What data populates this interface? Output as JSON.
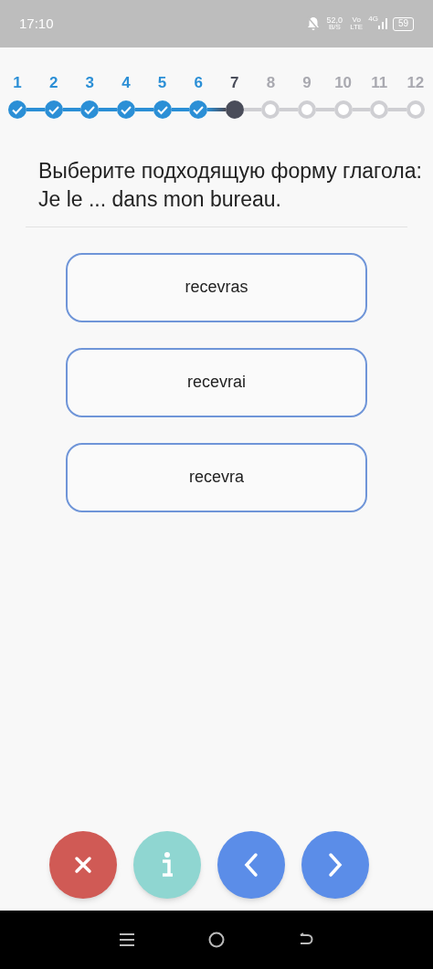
{
  "status_bar": {
    "time": "17:10",
    "speed": "52,0",
    "speed_unit": "B/S",
    "volte_top": "Vo",
    "volte_bottom": "LTE",
    "network": "4G",
    "battery": "59"
  },
  "steps": [
    {
      "label": "1",
      "done": true,
      "current": false
    },
    {
      "label": "2",
      "done": true,
      "current": false
    },
    {
      "label": "3",
      "done": true,
      "current": false
    },
    {
      "label": "4",
      "done": true,
      "current": false
    },
    {
      "label": "5",
      "done": true,
      "current": false
    },
    {
      "label": "6",
      "done": true,
      "current": false
    },
    {
      "label": "7",
      "done": false,
      "current": true
    },
    {
      "label": "8",
      "done": false,
      "current": false
    },
    {
      "label": "9",
      "done": false,
      "current": false
    },
    {
      "label": "10",
      "done": false,
      "current": false
    },
    {
      "label": "11",
      "done": false,
      "current": false
    },
    {
      "label": "12",
      "done": false,
      "current": false
    }
  ],
  "question": "Выберите подходящую форму глагола: Je le ... dans mon bureau.",
  "options": [
    {
      "label": "recevras",
      "selected": false
    },
    {
      "label": "recevrai",
      "selected": false
    },
    {
      "label": "recevra",
      "selected": false
    }
  ],
  "actions": [
    {
      "kind": "close"
    },
    {
      "kind": "info"
    },
    {
      "kind": "prev"
    },
    {
      "kind": "next"
    }
  ]
}
